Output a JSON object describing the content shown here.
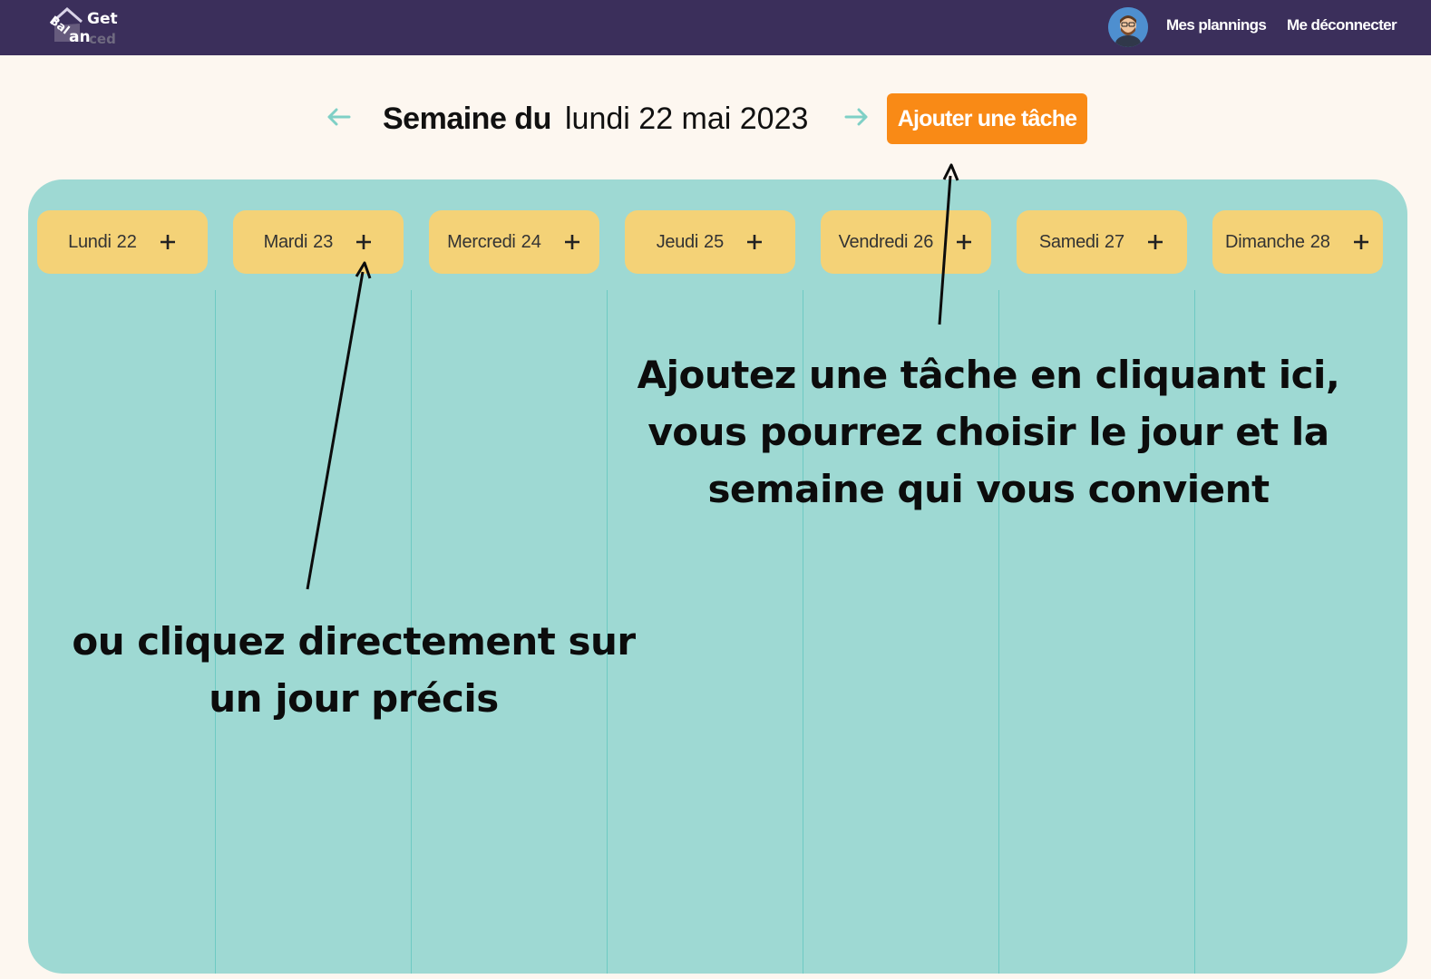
{
  "app": {
    "logo_text_top": "Get",
    "logo_text_left": "Bal",
    "logo_text_an": "an",
    "logo_text_ced": "ced"
  },
  "nav": {
    "plannings": "Mes plannings",
    "logout": "Me déconnecter"
  },
  "week": {
    "label": "Semaine du",
    "date": "lundi 22 mai 2023",
    "add_task": "Ajouter une tâche"
  },
  "days": [
    {
      "name": "Lundi",
      "num": "22"
    },
    {
      "name": "Mardi",
      "num": "23"
    },
    {
      "name": "Mercredi",
      "num": "24"
    },
    {
      "name": "Jeudi",
      "num": "25"
    },
    {
      "name": "Vendredi",
      "num": "26"
    },
    {
      "name": "Samedi",
      "num": "27"
    },
    {
      "name": "Dimanche",
      "num": "28"
    }
  ],
  "annotations": {
    "top_lines": [
      "Ajoutez une tâche en cliquant ici,",
      "vous pourrez choisir le jour et la",
      "semaine qui vous convient"
    ],
    "bottom_lines": [
      "ou cliquez directement sur",
      "un jour précis"
    ]
  },
  "colors": {
    "navbar": "#3b2f5b",
    "accent": "#f98a16",
    "board": "#9ed9d3",
    "day_pill": "#f4d277",
    "arrow": "#7fd0c6"
  },
  "icons": {
    "prev": "arrow-left-icon",
    "next": "arrow-right-icon",
    "add": "plus-icon"
  }
}
